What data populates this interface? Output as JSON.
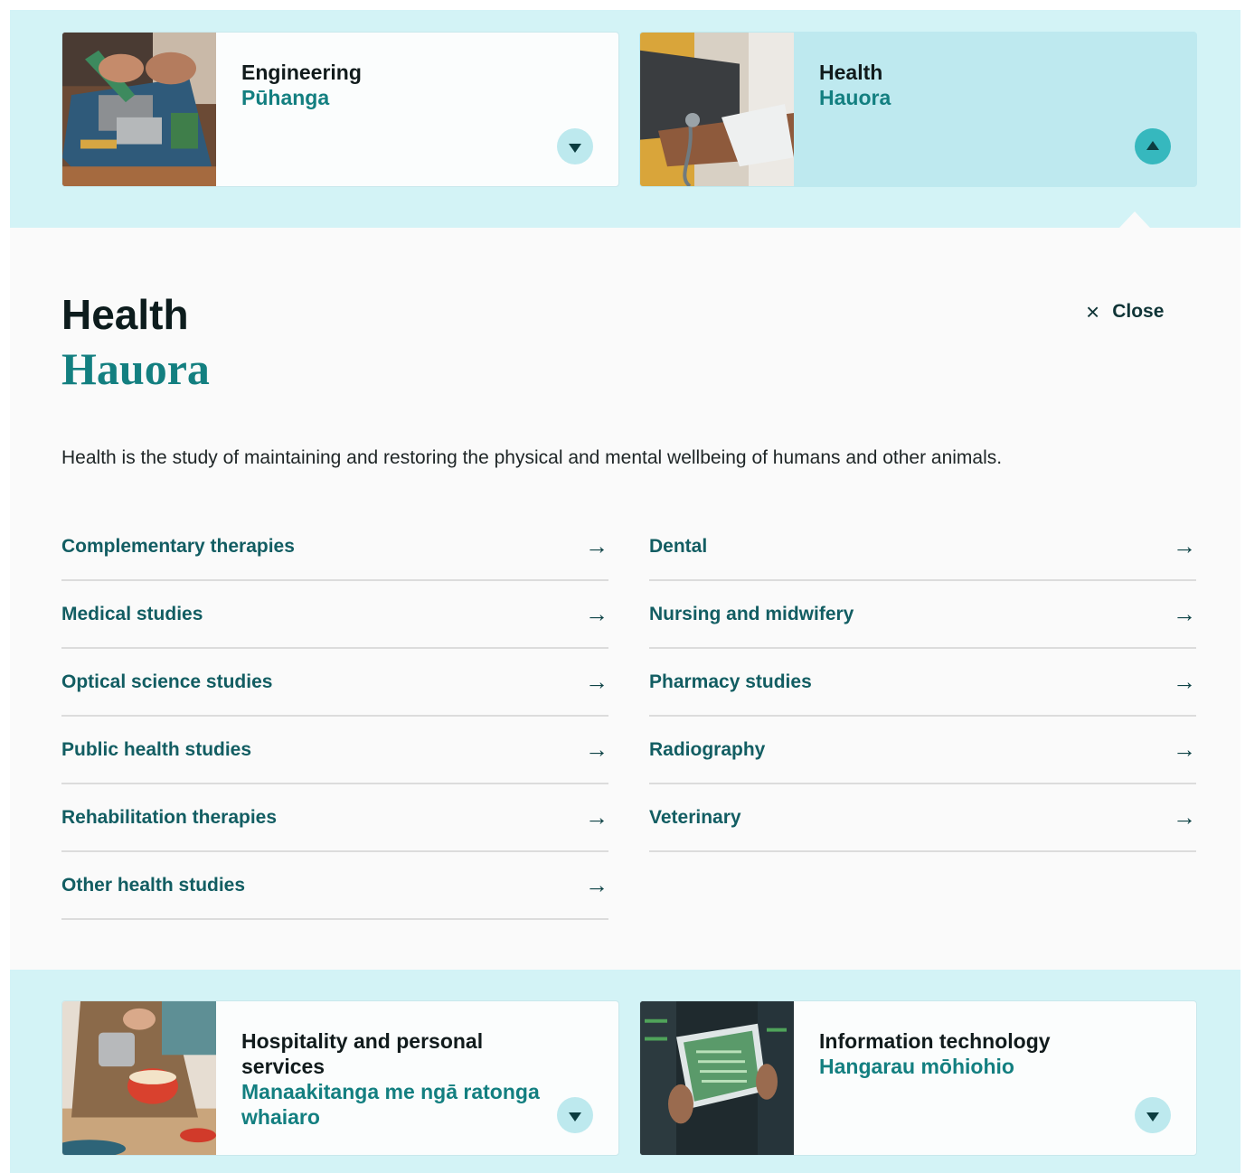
{
  "cards_top": [
    {
      "title_en": "Engineering",
      "title_mi": "Pūhanga",
      "expanded": false
    },
    {
      "title_en": "Health",
      "title_mi": "Hauora",
      "expanded": true
    }
  ],
  "panel": {
    "title_en": "Health",
    "title_mi": "Hauora",
    "close_label": "Close",
    "close_icon": "×",
    "description": "Health is the study of maintaining and restoring the physical and mental wellbeing of humans and other animals.",
    "links_left": [
      "Complementary therapies",
      "Medical studies",
      "Optical science studies",
      "Public health studies",
      "Rehabilitation therapies",
      "Other health studies"
    ],
    "links_right": [
      "Dental",
      "Nursing and midwifery",
      "Pharmacy studies",
      "Radiography",
      "Veterinary"
    ],
    "arrow_icon": "→"
  },
  "cards_bottom": [
    {
      "title_en": "Hospitality and personal services",
      "title_mi": "Manaakitanga me ngā ratonga whaiaro",
      "expanded": false
    },
    {
      "title_en": "Information technology",
      "title_mi": "Hangarau mōhiohio",
      "expanded": false
    }
  ],
  "colors": {
    "band": "#d3f3f6",
    "active_card": "#bee9ef",
    "teal_text": "#137f80",
    "link_text": "#125d62",
    "toggle_bg": "#bde9ee",
    "toggle_active_bg": "#36b8be"
  }
}
